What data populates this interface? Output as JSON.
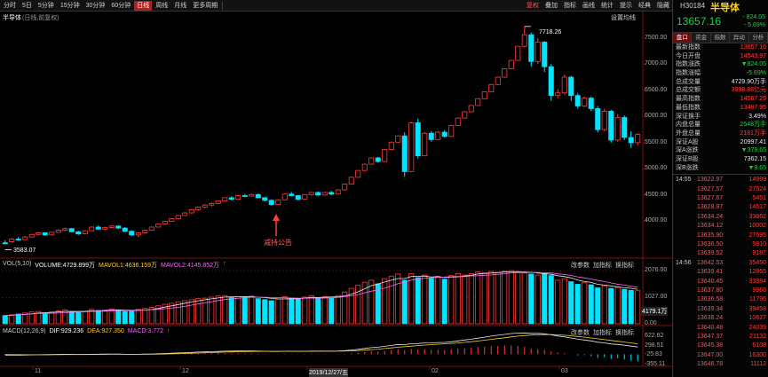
{
  "toolbar": {
    "periods": [
      "分时",
      "5日",
      "5分钟",
      "15分钟",
      "30分钟",
      "60分钟",
      "日线",
      "周线",
      "月线",
      "更多周期"
    ],
    "active_period": "日线",
    "tools": [
      "复权",
      "叠加",
      "指标",
      "画线",
      "统计",
      "提示",
      "经典",
      "隐藏"
    ]
  },
  "chart": {
    "stock_name": "半导体",
    "adjust_label": "(日线,前复权)",
    "settings_label": "设置均线",
    "high_label": "7718.26",
    "low_label": "3583.07",
    "annotation": "减持公告",
    "price_ticks": [
      "7500.00",
      "7000.00",
      "6500.00",
      "6000.00",
      "5500.00",
      "5000.00",
      "4500.00",
      "4000.00"
    ],
    "volume_header": {
      "title": "VOL(5,10)",
      "volume": "VOLUME:4729.899万",
      "mavol1": "MAVOL1:4636.159万",
      "mavol2": "MAVOL2:4145.852万"
    },
    "volume_ticks": [
      "2076.00",
      "1027.00",
      "0.00"
    ],
    "volume_current": "4179.1万",
    "macd_header": {
      "title": "MACD(12,26,9)",
      "dif": "DIF:929.236",
      "dea": "DEA:927.350",
      "macd": "MACD:3.772"
    },
    "macd_ticks": [
      "622.82",
      "298.51",
      "-25.83",
      "-355.11"
    ],
    "panel_buttons": [
      "改参数",
      "加指标",
      "换指标"
    ],
    "date_labels": [
      "11",
      "12",
      "2019/12/27/五",
      "02",
      "03"
    ],
    "colors": {
      "up": "#ff3c3c",
      "down": "#00e5ff",
      "mavol1": "#e8e8e8",
      "mavol2": "#ff66ff",
      "dif": "#e8e8e8",
      "dea": "#ffd020"
    }
  },
  "chart_data": {
    "type": "candlestick",
    "title": "半导体",
    "ylim": [
      3500,
      7800
    ],
    "price_ohlc": [
      [
        3590,
        3640,
        3560,
        3583
      ],
      [
        3610,
        3680,
        3590,
        3660
      ],
      [
        3660,
        3700,
        3630,
        3650
      ],
      [
        3650,
        3720,
        3640,
        3700
      ],
      [
        3700,
        3760,
        3690,
        3750
      ],
      [
        3750,
        3800,
        3730,
        3780
      ],
      [
        3780,
        3790,
        3720,
        3740
      ],
      [
        3740,
        3800,
        3730,
        3790
      ],
      [
        3790,
        3850,
        3780,
        3830
      ],
      [
        3830,
        3880,
        3810,
        3860
      ],
      [
        3860,
        3870,
        3790,
        3800
      ],
      [
        3800,
        3820,
        3740,
        3760
      ],
      [
        3760,
        3830,
        3750,
        3820
      ],
      [
        3820,
        3900,
        3810,
        3890
      ],
      [
        3890,
        3920,
        3840,
        3850
      ],
      [
        3850,
        3900,
        3830,
        3880
      ],
      [
        3880,
        3920,
        3860,
        3910
      ],
      [
        3910,
        3920,
        3850,
        3870
      ],
      [
        3870,
        3890,
        3800,
        3810
      ],
      [
        3810,
        3830,
        3720,
        3740
      ],
      [
        3740,
        3790,
        3700,
        3780
      ],
      [
        3780,
        3840,
        3770,
        3830
      ],
      [
        3830,
        3900,
        3820,
        3890
      ],
      [
        3890,
        3960,
        3880,
        3950
      ],
      [
        3950,
        4010,
        3940,
        4000
      ],
      [
        4000,
        4060,
        3990,
        4050
      ],
      [
        4050,
        4120,
        4040,
        4110
      ],
      [
        4110,
        4170,
        4100,
        4160
      ],
      [
        4160,
        4230,
        4150,
        4220
      ],
      [
        4220,
        4280,
        4200,
        4270
      ],
      [
        4270,
        4330,
        4250,
        4310
      ],
      [
        4310,
        4360,
        4290,
        4340
      ],
      [
        4340,
        4400,
        4330,
        4390
      ],
      [
        4390,
        4460,
        4380,
        4450
      ],
      [
        4450,
        4480,
        4400,
        4420
      ],
      [
        4420,
        4500,
        4410,
        4490
      ],
      [
        4490,
        4520,
        4460,
        4480
      ],
      [
        4480,
        4530,
        4470,
        4510
      ],
      [
        4510,
        4530,
        4440,
        4450
      ],
      [
        4450,
        4470,
        4380,
        4400
      ],
      [
        4400,
        4420,
        4300,
        4320
      ],
      [
        4320,
        4420,
        4310,
        4410
      ],
      [
        4410,
        4530,
        4400,
        4520
      ],
      [
        4520,
        4560,
        4480,
        4490
      ],
      [
        4490,
        4500,
        4400,
        4420
      ],
      [
        4420,
        4520,
        4410,
        4510
      ],
      [
        4510,
        4560,
        4490,
        4550
      ],
      [
        4550,
        4570,
        4490,
        4500
      ],
      [
        4500,
        4560,
        4490,
        4550
      ],
      [
        4550,
        4580,
        4500,
        4520
      ],
      [
        4520,
        4610,
        4510,
        4600
      ],
      [
        4600,
        4720,
        4590,
        4710
      ],
      [
        4710,
        4850,
        4700,
        4840
      ],
      [
        4840,
        4980,
        4830,
        4970
      ],
      [
        4970,
        5100,
        4960,
        5090
      ],
      [
        5090,
        5220,
        5080,
        5210
      ],
      [
        5210,
        5230,
        5120,
        5140
      ],
      [
        5140,
        5380,
        5130,
        5370
      ],
      [
        5370,
        5520,
        5360,
        5510
      ],
      [
        5510,
        5640,
        5500,
        5630
      ],
      [
        5630,
        5700,
        4850,
        4950
      ],
      [
        4950,
        5900,
        4940,
        5880
      ],
      [
        5880,
        5960,
        5200,
        5250
      ],
      [
        5250,
        5700,
        5240,
        5680
      ],
      [
        5680,
        5720,
        5520,
        5560
      ],
      [
        5560,
        5720,
        5550,
        5700
      ],
      [
        5700,
        5740,
        5600,
        5620
      ],
      [
        5620,
        5840,
        5610,
        5830
      ],
      [
        5830,
        5980,
        5820,
        5970
      ],
      [
        5970,
        6100,
        5960,
        6090
      ],
      [
        6090,
        6220,
        6080,
        6210
      ],
      [
        6210,
        6350,
        6200,
        6340
      ],
      [
        6340,
        6480,
        6330,
        6470
      ],
      [
        6470,
        6620,
        6460,
        6610
      ],
      [
        6610,
        6760,
        6600,
        6750
      ],
      [
        6750,
        6920,
        6740,
        6910
      ],
      [
        6910,
        7080,
        6900,
        7070
      ],
      [
        7070,
        7350,
        7060,
        7340
      ],
      [
        7340,
        7718,
        7320,
        7560
      ],
      [
        7560,
        7600,
        6950,
        7050
      ],
      [
        7050,
        7500,
        7000,
        7420
      ],
      [
        7420,
        7440,
        6850,
        6950
      ],
      [
        6950,
        7000,
        6300,
        6400
      ],
      [
        6400,
        6520,
        6350,
        6450
      ],
      [
        6450,
        6800,
        6420,
        6750
      ],
      [
        6750,
        6780,
        6300,
        6400
      ],
      [
        6400,
        6450,
        6150,
        6200
      ],
      [
        6200,
        6380,
        6180,
        6350
      ],
      [
        6350,
        6380,
        6100,
        6150
      ],
      [
        6150,
        6200,
        5700,
        5750
      ],
      [
        5750,
        6150,
        5720,
        6100
      ],
      [
        6100,
        6130,
        5500,
        5550
      ],
      [
        5550,
        6050,
        5520,
        5980
      ],
      [
        5980,
        6020,
        5550,
        5600
      ],
      [
        5600,
        5720,
        5400,
        5500
      ],
      [
        5500,
        5680,
        5450,
        5657
      ]
    ],
    "volume_max": 2076,
    "volume": [
      320,
      350,
      380,
      420,
      460,
      480,
      420,
      460,
      500,
      540,
      480,
      440,
      480,
      560,
      520,
      540,
      580,
      520,
      480,
      500,
      560,
      600,
      640,
      700,
      760,
      800,
      860,
      900,
      940,
      980,
      1000,
      1040,
      1080,
      1100,
      1020,
      1060,
      1040,
      1080,
      980,
      940,
      900,
      960,
      1060,
      1000,
      960,
      1040,
      1100,
      1020,
      1060,
      1000,
      1100,
      1240,
      1380,
      1500,
      1620,
      1700,
      1560,
      1760,
      1860,
      1940,
      1700,
      1960,
      1800,
      1900,
      1760,
      1820,
      1740,
      1880,
      1960,
      1900,
      1960,
      2020,
      1980,
      2040,
      2000,
      2050,
      2076,
      2000,
      1980,
      1940,
      1900,
      1960,
      1880,
      1700,
      1760,
      1640,
      1540,
      1600,
      1520,
      1400,
      1480,
      1380,
      1420,
      1340,
      1300,
      1290
    ],
    "macd_range": [
      -355.11,
      622.82
    ],
    "macd_hist": [
      -20,
      -25,
      -22,
      -18,
      -15,
      -10,
      -12,
      -8,
      -5,
      -2,
      -6,
      -10,
      -8,
      -4,
      -6,
      -4,
      -2,
      -5,
      -10,
      -15,
      -10,
      -5,
      0,
      5,
      10,
      15,
      20,
      25,
      30,
      35,
      38,
      40,
      42,
      45,
      35,
      38,
      30,
      32,
      20,
      12,
      5,
      10,
      18,
      12,
      5,
      12,
      18,
      10,
      12,
      5,
      10,
      20,
      35,
      55,
      80,
      100,
      90,
      120,
      150,
      180,
      140,
      180,
      160,
      180,
      150,
      160,
      140,
      170,
      200,
      210,
      230,
      250,
      260,
      280,
      290,
      300,
      310,
      290,
      260,
      200,
      180,
      150,
      100,
      60,
      40,
      0,
      -40,
      -30,
      -60,
      -120,
      -100,
      -160,
      -140,
      -180,
      -220,
      -240
    ],
    "macd_dif": [
      -30,
      -32,
      -28,
      -25,
      -20,
      -15,
      -14,
      -10,
      -5,
      0,
      -3,
      -8,
      -5,
      0,
      2,
      5,
      8,
      5,
      0,
      -5,
      0,
      5,
      10,
      18,
      26,
      35,
      45,
      55,
      65,
      75,
      82,
      90,
      98,
      106,
      108,
      112,
      112,
      115,
      110,
      104,
      96,
      98,
      104,
      104,
      100,
      104,
      110,
      108,
      110,
      108,
      112,
      125,
      145,
      170,
      200,
      230,
      245,
      275,
      305,
      340,
      330,
      365,
      370,
      390,
      395,
      405,
      410,
      430,
      460,
      490,
      520,
      555,
      590,
      625,
      655,
      685,
      715,
      730,
      735,
      720,
      720,
      705,
      670,
      630,
      600,
      560,
      520,
      490,
      460,
      415,
      395,
      355,
      340,
      310,
      280,
      250
    ],
    "macd_dea": [
      -10,
      -12,
      -14,
      -16,
      -17,
      -17,
      -17,
      -16,
      -14,
      -11,
      -10,
      -10,
      -9,
      -7,
      -5,
      -3,
      -1,
      0,
      0,
      -1,
      -1,
      0,
      2,
      5,
      9,
      14,
      20,
      27,
      35,
      43,
      51,
      59,
      67,
      75,
      81,
      87,
      92,
      97,
      100,
      101,
      101,
      101,
      102,
      102,
      102,
      102,
      104,
      105,
      106,
      106,
      107,
      111,
      118,
      128,
      142,
      160,
      177,
      197,
      219,
      243,
      261,
      282,
      299,
      317,
      333,
      347,
      360,
      374,
      391,
      411,
      433,
      457,
      484,
      512,
      540,
      569,
      598,
      625,
      647,
      662,
      673,
      680,
      679,
      669,
      655,
      636,
      613,
      588,
      562,
      533,
      505,
      475,
      448,
      420,
      392,
      364
    ]
  },
  "quote": {
    "code": "H30184",
    "name": "半导体",
    "price": "13657.16",
    "change": "- 824.05",
    "change_pct": "- 5.69%",
    "tabs": [
      "盘口",
      "资金",
      "指数",
      "异动",
      "分析"
    ],
    "stats": [
      {
        "label": "最新指数",
        "value": "13657.16",
        "color": "red"
      },
      {
        "label": "今日开盘",
        "value": "14543.97",
        "color": "red"
      },
      {
        "label": "指数涨跌",
        "value": "▼824.05",
        "color": "green"
      },
      {
        "label": "指数涨幅",
        "value": "-5.69%",
        "color": "green"
      },
      {
        "label": "总成交量",
        "value": "4729.90万手",
        "color": "white"
      },
      {
        "label": "总成交额",
        "value": "3998.88亿元",
        "color": "red"
      },
      {
        "label": "最高指数",
        "value": "14567.29",
        "color": "red"
      },
      {
        "label": "最低指数",
        "value": "13487.95",
        "color": "red"
      },
      {
        "label": "深证换手",
        "value": "3.49%",
        "color": "white"
      },
      {
        "label": "内盘总量",
        "value": "2548万手",
        "color": "green"
      },
      {
        "label": "外盘总量",
        "value": "2181万手",
        "color": "red"
      },
      {
        "label": "深证A股",
        "value": "20997.41",
        "color": "white"
      },
      {
        "label": "深A涨跌",
        "value": "▼379.65",
        "color": "green"
      },
      {
        "label": "深证B股",
        "value": "7362.15",
        "color": "white"
      },
      {
        "label": "深B涨跌",
        "value": "▼9.65",
        "color": "green"
      }
    ],
    "ticks": [
      {
        "time": "14:55",
        "price": "13622.97",
        "vol": "14999"
      },
      {
        "time": "",
        "price": "13627.57",
        "vol": "27524"
      },
      {
        "time": "",
        "price": "13627.67",
        "vol": "5451"
      },
      {
        "time": "",
        "price": "13628.97",
        "vol": "14517"
      },
      {
        "time": "",
        "price": "13634.24",
        "vol": "33862"
      },
      {
        "time": "",
        "price": "13634.12",
        "vol": "10002"
      },
      {
        "time": "",
        "price": "13635.90",
        "vol": "27695"
      },
      {
        "time": "",
        "price": "13636.50",
        "vol": "5910"
      },
      {
        "time": "",
        "price": "13639.52",
        "vol": "9187"
      },
      {
        "time": "14:56",
        "price": "13642.53",
        "vol": "35450"
      },
      {
        "time": "",
        "price": "13639.41",
        "vol": "12865"
      },
      {
        "time": "",
        "price": "13640.45",
        "vol": "33384"
      },
      {
        "time": "",
        "price": "13637.80",
        "vol": "9966"
      },
      {
        "time": "",
        "price": "13636.58",
        "vol": "11796"
      },
      {
        "time": "",
        "price": "13639.34",
        "vol": "39458"
      },
      {
        "time": "",
        "price": "13638.24",
        "vol": "10627"
      },
      {
        "time": "",
        "price": "13640.48",
        "vol": "24039"
      },
      {
        "time": "",
        "price": "13647.37",
        "vol": "21132"
      },
      {
        "time": "",
        "price": "13645.38",
        "vol": "6108"
      },
      {
        "time": "",
        "price": "13647.00",
        "vol": "16300"
      },
      {
        "time": "",
        "price": "13646.78",
        "vol": "11112"
      }
    ]
  }
}
